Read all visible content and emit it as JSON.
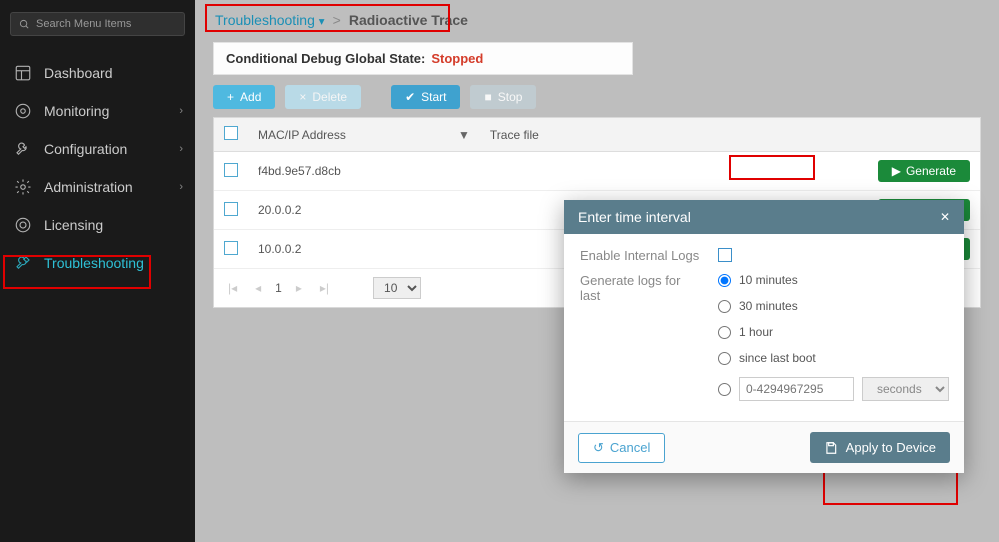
{
  "search": {
    "placeholder": "Search Menu Items"
  },
  "sidebar": {
    "items": [
      {
        "label": "Dashboard"
      },
      {
        "label": "Monitoring"
      },
      {
        "label": "Configuration"
      },
      {
        "label": "Administration"
      },
      {
        "label": "Licensing"
      },
      {
        "label": "Troubleshooting"
      }
    ]
  },
  "breadcrumb": {
    "root": "Troubleshooting",
    "sep": ">",
    "current": "Radioactive Trace"
  },
  "status": {
    "label": "Conditional Debug Global State:",
    "value": "Stopped"
  },
  "toolbar": {
    "add": "Add",
    "delete": "Delete",
    "start": "Start",
    "stop": "Stop"
  },
  "table": {
    "headers": {
      "mac": "MAC/IP Address",
      "trace": "Trace file"
    },
    "rows": [
      {
        "addr": "f4bd.9e57.d8cb",
        "gen": "Generate"
      },
      {
        "addr": "20.0.0.2",
        "gen": "Generate"
      },
      {
        "addr": "10.0.0.2",
        "gen": "Generate"
      }
    ],
    "page": "1",
    "page_size": "10"
  },
  "modal": {
    "title": "Enter time interval",
    "enable_label": "Enable Internal Logs",
    "gen_label": "Generate logs for last",
    "options": [
      "10 minutes",
      "30 minutes",
      "1 hour",
      "since last boot"
    ],
    "custom_placeholder": "0-4294967295",
    "unit": "seconds",
    "cancel": "Cancel",
    "apply": "Apply to Device"
  }
}
